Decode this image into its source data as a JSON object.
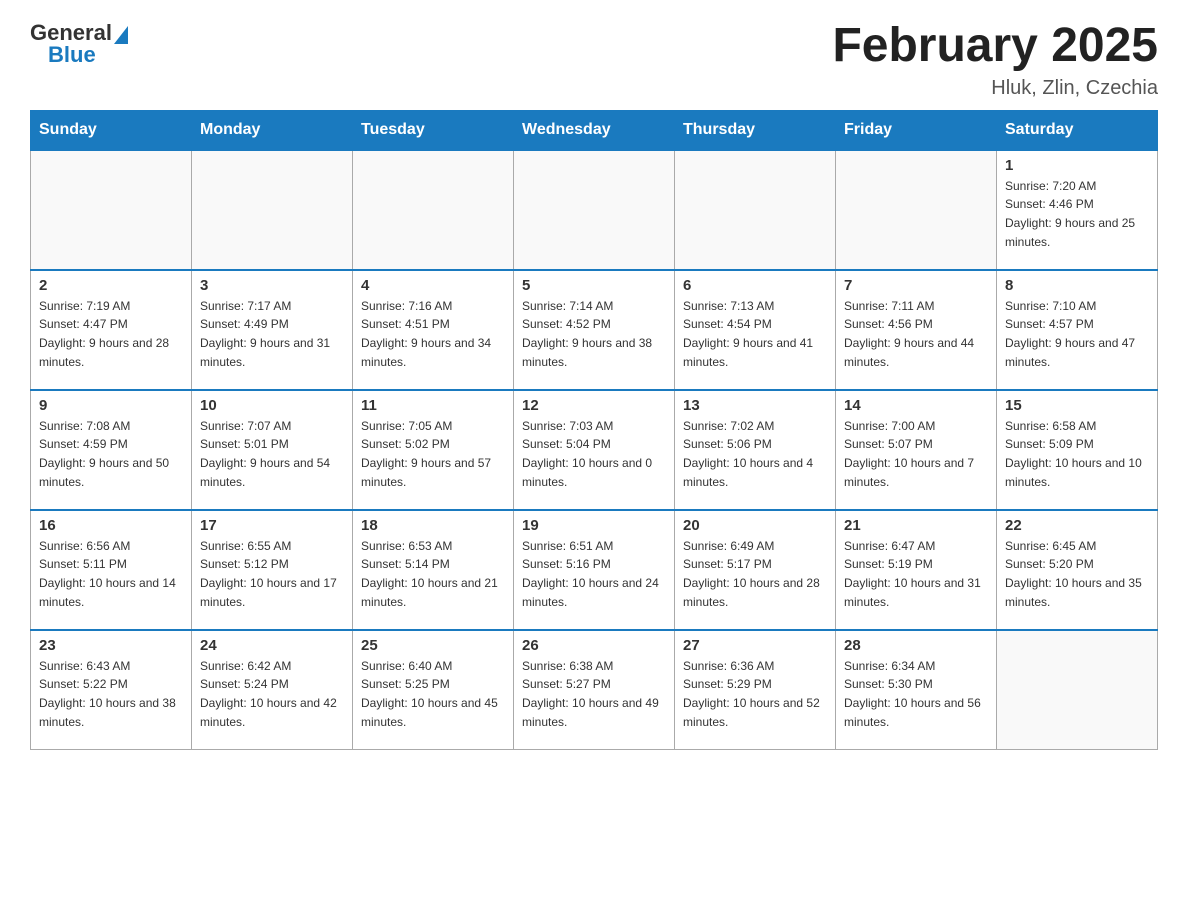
{
  "header": {
    "logo_general": "General",
    "logo_blue": "Blue",
    "month_title": "February 2025",
    "location": "Hluk, Zlin, Czechia"
  },
  "days_of_week": [
    "Sunday",
    "Monday",
    "Tuesday",
    "Wednesday",
    "Thursday",
    "Friday",
    "Saturday"
  ],
  "weeks": [
    [
      {
        "day": "",
        "info": ""
      },
      {
        "day": "",
        "info": ""
      },
      {
        "day": "",
        "info": ""
      },
      {
        "day": "",
        "info": ""
      },
      {
        "day": "",
        "info": ""
      },
      {
        "day": "",
        "info": ""
      },
      {
        "day": "1",
        "info": "Sunrise: 7:20 AM\nSunset: 4:46 PM\nDaylight: 9 hours and 25 minutes."
      }
    ],
    [
      {
        "day": "2",
        "info": "Sunrise: 7:19 AM\nSunset: 4:47 PM\nDaylight: 9 hours and 28 minutes."
      },
      {
        "day": "3",
        "info": "Sunrise: 7:17 AM\nSunset: 4:49 PM\nDaylight: 9 hours and 31 minutes."
      },
      {
        "day": "4",
        "info": "Sunrise: 7:16 AM\nSunset: 4:51 PM\nDaylight: 9 hours and 34 minutes."
      },
      {
        "day": "5",
        "info": "Sunrise: 7:14 AM\nSunset: 4:52 PM\nDaylight: 9 hours and 38 minutes."
      },
      {
        "day": "6",
        "info": "Sunrise: 7:13 AM\nSunset: 4:54 PM\nDaylight: 9 hours and 41 minutes."
      },
      {
        "day": "7",
        "info": "Sunrise: 7:11 AM\nSunset: 4:56 PM\nDaylight: 9 hours and 44 minutes."
      },
      {
        "day": "8",
        "info": "Sunrise: 7:10 AM\nSunset: 4:57 PM\nDaylight: 9 hours and 47 minutes."
      }
    ],
    [
      {
        "day": "9",
        "info": "Sunrise: 7:08 AM\nSunset: 4:59 PM\nDaylight: 9 hours and 50 minutes."
      },
      {
        "day": "10",
        "info": "Sunrise: 7:07 AM\nSunset: 5:01 PM\nDaylight: 9 hours and 54 minutes."
      },
      {
        "day": "11",
        "info": "Sunrise: 7:05 AM\nSunset: 5:02 PM\nDaylight: 9 hours and 57 minutes."
      },
      {
        "day": "12",
        "info": "Sunrise: 7:03 AM\nSunset: 5:04 PM\nDaylight: 10 hours and 0 minutes."
      },
      {
        "day": "13",
        "info": "Sunrise: 7:02 AM\nSunset: 5:06 PM\nDaylight: 10 hours and 4 minutes."
      },
      {
        "day": "14",
        "info": "Sunrise: 7:00 AM\nSunset: 5:07 PM\nDaylight: 10 hours and 7 minutes."
      },
      {
        "day": "15",
        "info": "Sunrise: 6:58 AM\nSunset: 5:09 PM\nDaylight: 10 hours and 10 minutes."
      }
    ],
    [
      {
        "day": "16",
        "info": "Sunrise: 6:56 AM\nSunset: 5:11 PM\nDaylight: 10 hours and 14 minutes."
      },
      {
        "day": "17",
        "info": "Sunrise: 6:55 AM\nSunset: 5:12 PM\nDaylight: 10 hours and 17 minutes."
      },
      {
        "day": "18",
        "info": "Sunrise: 6:53 AM\nSunset: 5:14 PM\nDaylight: 10 hours and 21 minutes."
      },
      {
        "day": "19",
        "info": "Sunrise: 6:51 AM\nSunset: 5:16 PM\nDaylight: 10 hours and 24 minutes."
      },
      {
        "day": "20",
        "info": "Sunrise: 6:49 AM\nSunset: 5:17 PM\nDaylight: 10 hours and 28 minutes."
      },
      {
        "day": "21",
        "info": "Sunrise: 6:47 AM\nSunset: 5:19 PM\nDaylight: 10 hours and 31 minutes."
      },
      {
        "day": "22",
        "info": "Sunrise: 6:45 AM\nSunset: 5:20 PM\nDaylight: 10 hours and 35 minutes."
      }
    ],
    [
      {
        "day": "23",
        "info": "Sunrise: 6:43 AM\nSunset: 5:22 PM\nDaylight: 10 hours and 38 minutes."
      },
      {
        "day": "24",
        "info": "Sunrise: 6:42 AM\nSunset: 5:24 PM\nDaylight: 10 hours and 42 minutes."
      },
      {
        "day": "25",
        "info": "Sunrise: 6:40 AM\nSunset: 5:25 PM\nDaylight: 10 hours and 45 minutes."
      },
      {
        "day": "26",
        "info": "Sunrise: 6:38 AM\nSunset: 5:27 PM\nDaylight: 10 hours and 49 minutes."
      },
      {
        "day": "27",
        "info": "Sunrise: 6:36 AM\nSunset: 5:29 PM\nDaylight: 10 hours and 52 minutes."
      },
      {
        "day": "28",
        "info": "Sunrise: 6:34 AM\nSunset: 5:30 PM\nDaylight: 10 hours and 56 minutes."
      },
      {
        "day": "",
        "info": ""
      }
    ]
  ]
}
